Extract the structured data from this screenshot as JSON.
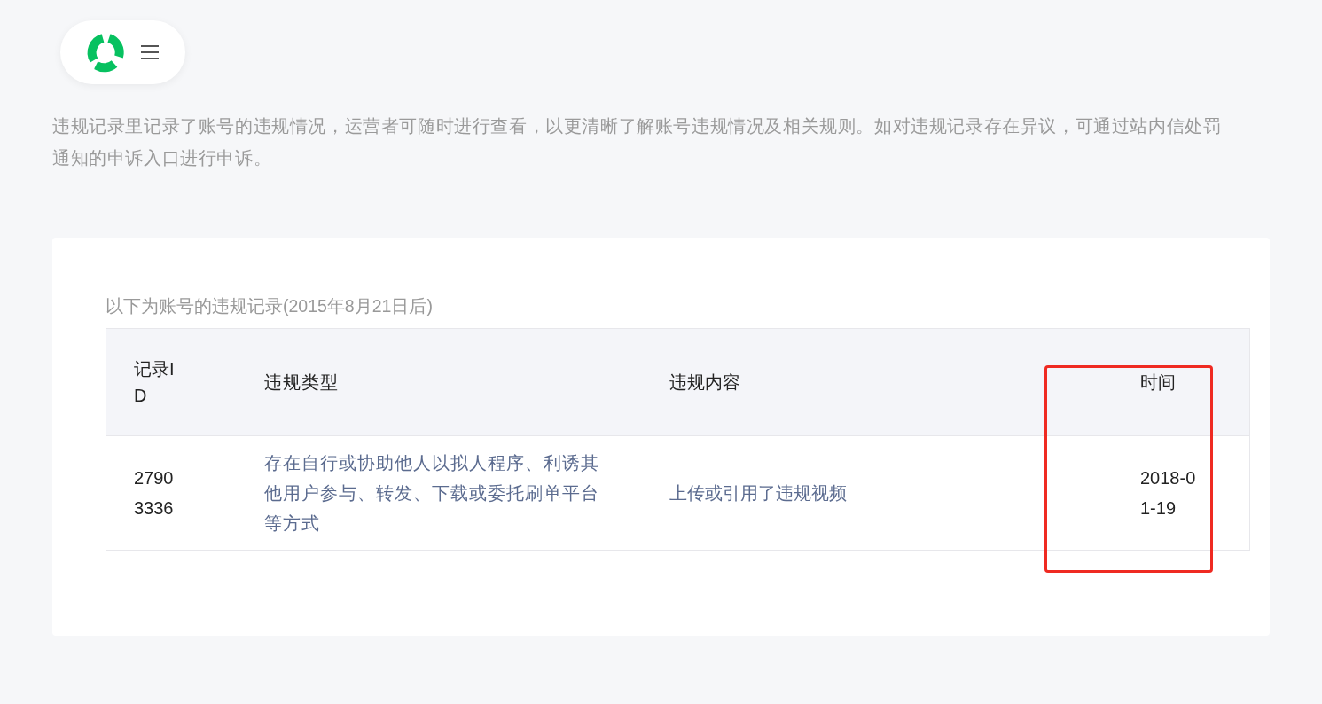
{
  "description": "违规记录里记录了账号的违规情况，运营者可随时进行查看，以更清晰了解账号违规情况及相关规则。如对违规记录存在异议，可通过站内信处罚通知的申诉入口进行申诉。",
  "records": {
    "caption": "以下为账号的违规记录(2015年8月21日后)",
    "columns": [
      {
        "label": "记录ID",
        "highlighted": false
      },
      {
        "label": "违规类型",
        "highlighted": false
      },
      {
        "label": "违规内容",
        "highlighted": false
      },
      {
        "label": "时间",
        "highlighted": true
      }
    ],
    "rows": [
      [
        "27903336",
        "存在自行或协助他人以拟人程序、利诱其他用户参与、转发、下载或委托刷单平台等方式",
        "上传或引用了违规视频",
        "2018-01-19"
      ]
    ]
  }
}
